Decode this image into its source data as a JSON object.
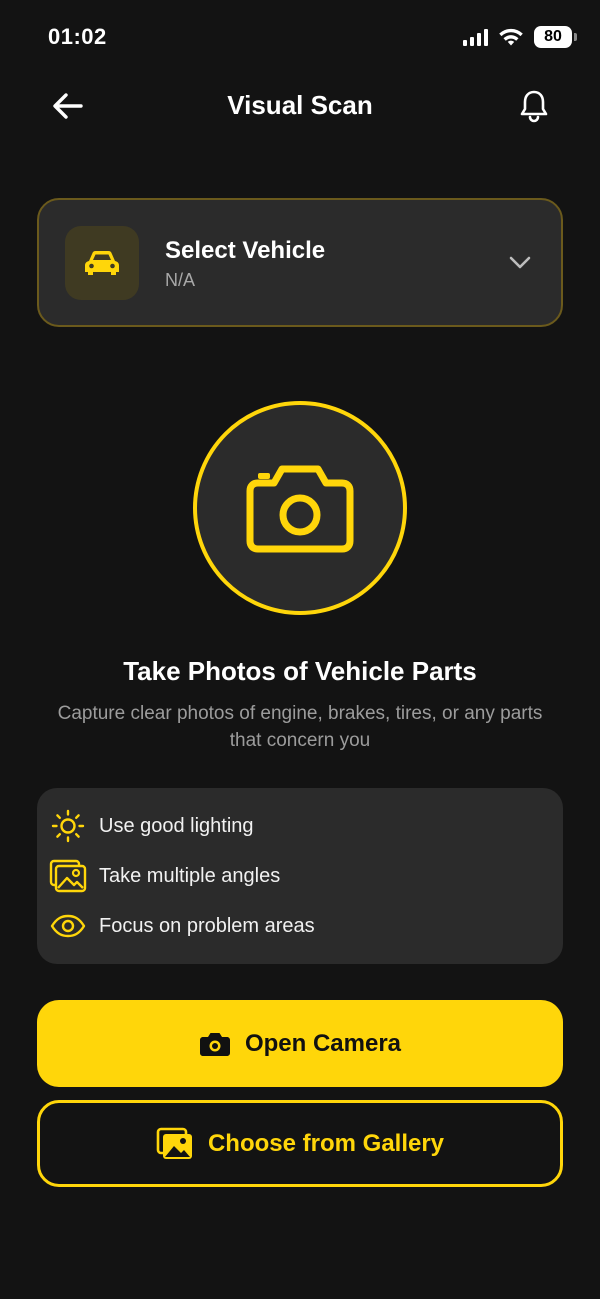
{
  "status_bar": {
    "time": "01:02",
    "battery": "80"
  },
  "nav": {
    "title": "Visual Scan",
    "back_icon": "arrow-left-icon",
    "bell_icon": "bell-icon"
  },
  "vehicle_selector": {
    "title": "Select Vehicle",
    "value": "N/A",
    "icon": "car-icon"
  },
  "hero": {
    "icon": "camera-icon",
    "heading": "Take Photos of Vehicle Parts",
    "subtext": "Capture clear photos of engine, brakes, tires, or any parts that concern you"
  },
  "tips": [
    {
      "icon": "sun-icon",
      "label": "Use good lighting"
    },
    {
      "icon": "images-icon",
      "label": "Take multiple angles"
    },
    {
      "icon": "eye-icon",
      "label": "Focus on problem areas"
    }
  ],
  "actions": {
    "open_camera": "Open Camera",
    "choose_gallery": "Choose from Gallery"
  },
  "colors": {
    "background": "#131313",
    "card": "#2b2b2b",
    "accent": "#ffd60a",
    "muted_text": "#9c9c9c"
  }
}
